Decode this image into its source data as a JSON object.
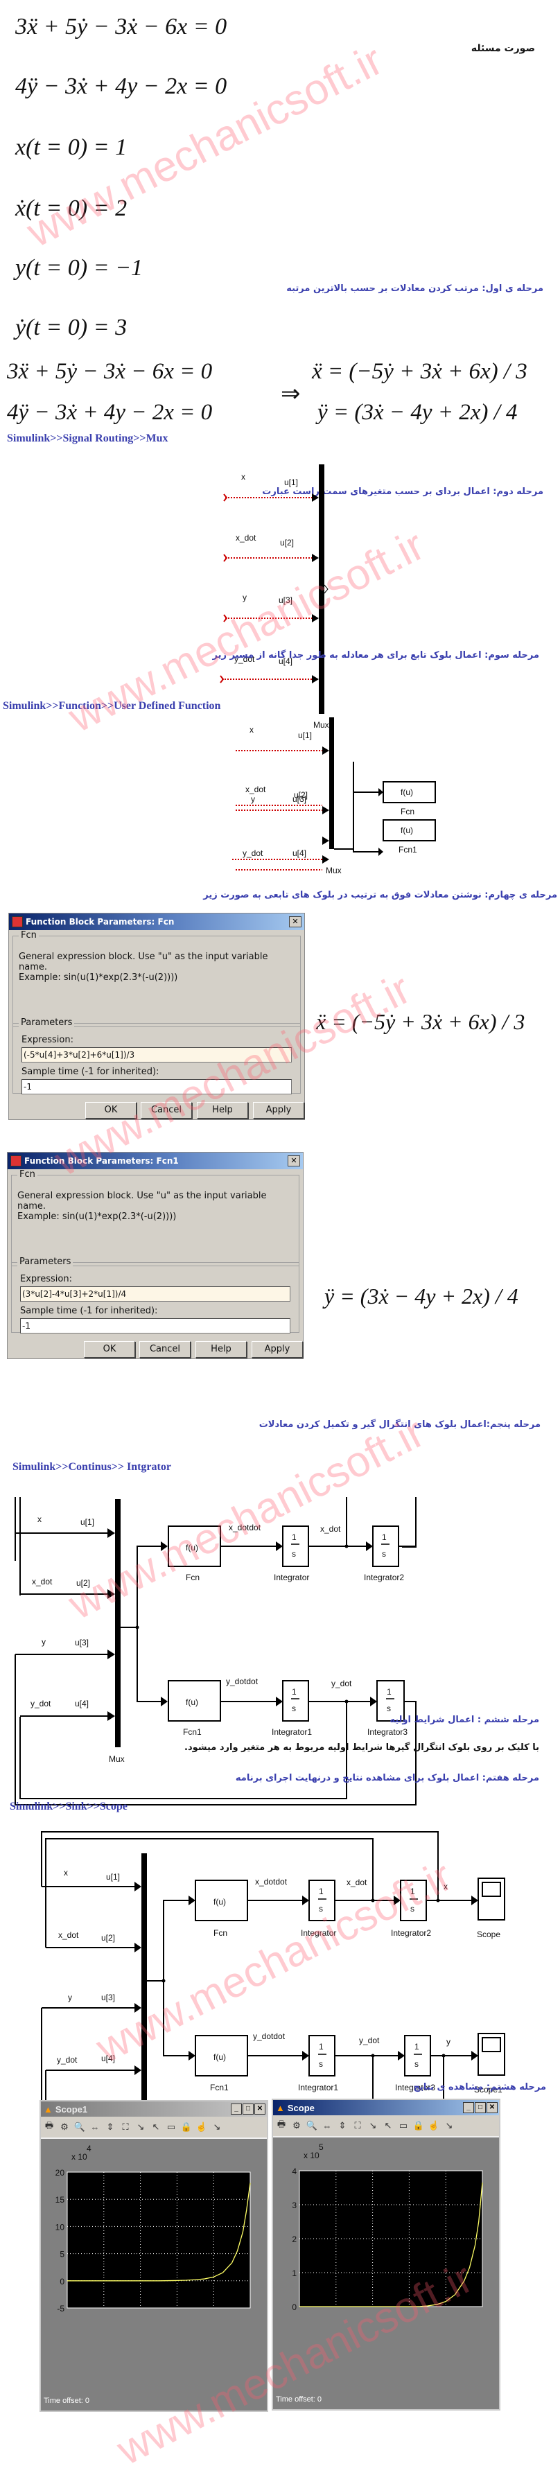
{
  "watermark": "www.mechanicsoft.ir",
  "problem": {
    "heading": "صورت مسئله",
    "equations": [
      "3ẍ + 5ẏ − 3ẋ − 6x = 0",
      "4ÿ − 3ẋ + 4y − 2x = 0",
      "x(t = 0) = 1",
      "ẋ(t = 0) = 2",
      "y(t = 0) = −1",
      "ẏ(t = 0) = 3"
    ]
  },
  "step1": {
    "heading": "مرحله ی اول: مرتب کردن معادلات بر حسب بالاترین مرتبه",
    "left": [
      "3ẍ + 5ẏ − 3ẋ − 6x = 0",
      "4ÿ − 3ẋ + 4y − 2x = 0"
    ],
    "arrow": "⇒",
    "right": [
      "ẍ = (−5ẏ + 3ẋ + 6x) / 3",
      "ÿ = (3ẋ − 4y + 2x) / 4"
    ]
  },
  "step2": {
    "heading": "مرحله دوم: اعمال بردای بر حسب متغیرهای سمت راست عبارت",
    "path": "Simulink>>Signal Routing>>Mux",
    "signals": [
      "x",
      "x_dot",
      "y",
      "y_dot"
    ],
    "ports": [
      "u[1]",
      "u[2]",
      "u[3]",
      "u[4]"
    ],
    "mux_label": "Mux"
  },
  "step3": {
    "heading": "مرحله سوم: اعمال بلوک تابع برای هر معادله به طور جدا گانه از مسیر زیر",
    "path": "Simulink>>Function>>User Defined Function",
    "signals": [
      "x",
      "x_dot",
      "y",
      "y_dot"
    ],
    "ports": [
      "u[1]",
      "u[2]",
      "u[3]",
      "u[4]"
    ],
    "mux_label": "Mux",
    "fcn_text": "f(u)",
    "fcn_labels": [
      "Fcn",
      "Fcn1"
    ]
  },
  "step4": {
    "heading": "مرحله ی چهارم: نوشتن معادلات فوق  به ترتیب در بلوک های تابعی به صورت زیر",
    "dialogs": [
      {
        "title": "Function Block Parameters: Fcn",
        "group": "Fcn",
        "description": "General expression block. Use \"u\" as the input variable name.",
        "example": "Example: sin(u(1)*exp(2.3*(-u(2))))",
        "params_label": "Parameters",
        "expression_label": "Expression:",
        "expression_value": "(-5*u[4]+3*u[2]+6*u[1])/3",
        "sample_label": "Sample time (-1 for inherited):",
        "sample_value": "-1",
        "buttons": [
          "OK",
          "Cancel",
          "Help",
          "Apply"
        ],
        "equation": "ẍ = (−5ẏ + 3ẋ + 6x) / 3"
      },
      {
        "title": "Function Block Parameters: Fcn1",
        "group": "Fcn",
        "description": "General expression block. Use \"u\" as the input variable name.",
        "example": "Example: sin(u(1)*exp(2.3*(-u(2))))",
        "params_label": "Parameters",
        "expression_label": "Expression:",
        "expression_value": "(3*u[2]-4*u[3]+2*u[1])/4",
        "sample_label": "Sample time (-1 for inherited):",
        "sample_value": "-1",
        "buttons": [
          "OK",
          "Cancel",
          "Help",
          "Apply"
        ],
        "equation": "ÿ = (3ẋ − 4y + 2x) / 4"
      }
    ]
  },
  "step5": {
    "heading": "مرحله پنجم:اعمال بلوک های انتگرال گیر  و تکمیل کردن معادلات",
    "path": "Simulink>>Continus>> Intgrator",
    "signals": [
      "x",
      "x_dot",
      "y",
      "y_dot"
    ],
    "ports": [
      "u[1]",
      "u[2]",
      "u[3]",
      "u[4]"
    ],
    "mux_label": "Mux",
    "fcn_text": "f(u)",
    "fcn_labels": [
      "Fcn",
      "Fcn1"
    ],
    "int_num": "1",
    "int_den": "s",
    "int_labels": [
      "Integrator",
      "Integrator2",
      "Integrator1",
      "Integrator3"
    ],
    "wire_labels": [
      "x_dotdot",
      "x_dot",
      "y_dotdot",
      "y_dot"
    ]
  },
  "step6": {
    "heading": "مرحله ششم : اعمال شرایط اولیه",
    "note": "با کلیک بر روی بلوک انتگرال گیرها شرایط اولیه مربوط به هر متغیر وارد میشود."
  },
  "step7": {
    "heading": "مرحله هفتم: اعمال بلوک برای مشاهده نتایج و درنهایت اجرای برنامه",
    "path": "Simulink>>Sink>>Scope",
    "signals": [
      "x",
      "x_dot",
      "y",
      "y_dot"
    ],
    "ports": [
      "u[1]",
      "u[2]",
      "u[3]",
      "u[4]"
    ],
    "mux_label": "Mux",
    "fcn_text": "f(u)",
    "fcn_labels": [
      "Fcn",
      "Fcn1"
    ],
    "int_num": "1",
    "int_den": "s",
    "int_labels": [
      "Integrator",
      "Integrator2",
      "Integrator1",
      "Integrator3"
    ],
    "wire_labels": [
      "x_dotdot",
      "x_dot",
      "x",
      "y_dotdot",
      "y_dot",
      "y"
    ],
    "scope_labels": [
      "Scope",
      "Scope1"
    ]
  },
  "step8": {
    "heading": "مرحله هشتم: مشاهده ی نتایج"
  },
  "scopes": [
    {
      "title": "Scope1",
      "active": false,
      "time_offset_label": "Time offset:",
      "time_offset_value": "0",
      "toolbar": [
        "print-icon",
        "parameters-icon",
        "zoom-icon",
        "zoom-x-icon",
        "zoom-y-icon",
        "autoscale-icon",
        "save-axes-icon",
        "restore-axes-icon",
        "floating-scope-icon",
        "lock-icon",
        "signal-selection-icon",
        "dock-icon"
      ]
    },
    {
      "title": "Scope",
      "active": true,
      "time_offset_label": "Time offset:",
      "time_offset_value": "0",
      "toolbar": [
        "print-icon",
        "parameters-icon",
        "zoom-icon",
        "zoom-x-icon",
        "zoom-y-icon",
        "autoscale-icon",
        "save-axes-icon",
        "restore-axes-icon",
        "floating-scope-icon",
        "lock-icon",
        "signal-selection-icon",
        "dock-icon"
      ]
    }
  ],
  "chart_data": [
    {
      "type": "line",
      "title": "Scope1",
      "xlabel": "",
      "ylabel": "",
      "y_multiplier": "x 10^4",
      "xlim": [
        0,
        10
      ],
      "ylim": [
        -5,
        20
      ],
      "xticks": [
        0,
        2,
        4,
        6,
        8,
        10
      ],
      "yticks": [
        -5,
        0,
        5,
        10,
        15,
        20
      ],
      "grid": true,
      "line_color": "#ffff66",
      "background": "#000000",
      "series": [
        {
          "name": "y",
          "x": [
            0,
            1,
            2,
            3,
            4,
            5,
            6,
            6.5,
            7,
            7.5,
            8,
            8.5,
            9,
            9.3,
            9.6,
            9.8,
            10
          ],
          "values": [
            0,
            0,
            0,
            0,
            0,
            0,
            0.05,
            0.1,
            0.2,
            0.35,
            0.7,
            1.5,
            3.3,
            5.5,
            9,
            13,
            18
          ]
        }
      ]
    },
    {
      "type": "line",
      "title": "Scope",
      "xlabel": "",
      "ylabel": "",
      "y_multiplier": "x 10^5",
      "xlim": [
        0,
        10
      ],
      "ylim": [
        0,
        4
      ],
      "xticks": [
        0,
        2,
        4,
        6,
        8,
        10
      ],
      "yticks": [
        0,
        1,
        2,
        3,
        4
      ],
      "grid": true,
      "line_color": "#ffff66",
      "background": "#000000",
      "series": [
        {
          "name": "x",
          "x": [
            0,
            1,
            2,
            3,
            4,
            5,
            6,
            6.6,
            7,
            7.5,
            8,
            8.5,
            9,
            9.3,
            9.6,
            9.8,
            10
          ],
          "values": [
            0,
            0,
            0,
            0,
            0,
            0,
            0,
            0.005,
            0.02,
            0.06,
            0.15,
            0.35,
            0.75,
            1.15,
            1.8,
            2.5,
            3.65
          ]
        }
      ]
    }
  ]
}
